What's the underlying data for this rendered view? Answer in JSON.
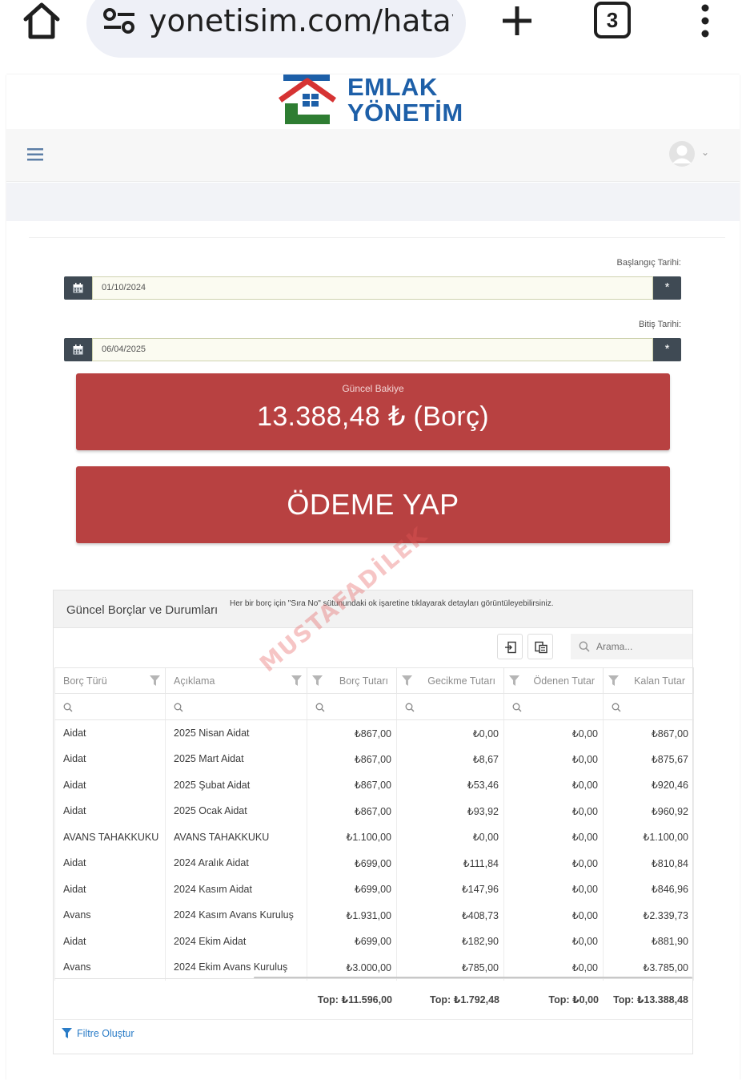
{
  "browser": {
    "url": "yonetisim.com/hatay-a",
    "tab_count": "3"
  },
  "site": {
    "logo_line1": "EMLAK",
    "logo_line2": "YÖNETİM"
  },
  "dates": {
    "start_label": "Başlangıç Tarihi:",
    "start_value": "01/10/2024",
    "end_label": "Bitiş Tarihi:",
    "end_value": "06/04/2025",
    "clear_symbol": "*"
  },
  "balance": {
    "label": "Güncel Bakiye",
    "value": "13.388,48 ₺ (Borç)"
  },
  "pay_button": "ÖDEME YAP",
  "panel": {
    "title": "Güncel Borçlar ve Durumları",
    "hint": "Her bir borç için \"Sıra No\" sütunundaki ok işaretine tıklayarak detayları görüntüleyebilirsiniz.",
    "search_placeholder": "Arama..."
  },
  "table": {
    "columns": [
      "Borç Türü",
      "Açıklama",
      "Borç Tutarı",
      "Gecikme Tutarı",
      "Ödenen Tutar",
      "Kalan Tutar"
    ],
    "rows": [
      [
        "Aidat",
        "2025 Nisan Aidat",
        "₺867,00",
        "₺0,00",
        "₺0,00",
        "₺867,00"
      ],
      [
        "Aidat",
        "2025 Mart Aidat",
        "₺867,00",
        "₺8,67",
        "₺0,00",
        "₺875,67"
      ],
      [
        "Aidat",
        "2025 Şubat Aidat",
        "₺867,00",
        "₺53,46",
        "₺0,00",
        "₺920,46"
      ],
      [
        "Aidat",
        "2025 Ocak Aidat",
        "₺867,00",
        "₺93,92",
        "₺0,00",
        "₺960,92"
      ],
      [
        "AVANS TAHAKKUKU",
        "AVANS TAHAKKUKU",
        "₺1.100,00",
        "₺0,00",
        "₺0,00",
        "₺1.100,00"
      ],
      [
        "Aidat",
        "2024 Aralık Aidat",
        "₺699,00",
        "₺111,84",
        "₺0,00",
        "₺810,84"
      ],
      [
        "Aidat",
        "2024 Kasım Aidat",
        "₺699,00",
        "₺147,96",
        "₺0,00",
        "₺846,96"
      ],
      [
        "Avans",
        "2024 Kasım Avans Kuruluş",
        "₺1.931,00",
        "₺408,73",
        "₺0,00",
        "₺2.339,73"
      ],
      [
        "Aidat",
        "2024 Ekim Aidat",
        "₺699,00",
        "₺182,90",
        "₺0,00",
        "₺881,90"
      ],
      [
        "Avans",
        "2024 Ekim Avans Kuruluş",
        "₺3.000,00",
        "₺785,00",
        "₺0,00",
        "₺3.785,00"
      ]
    ],
    "totals": {
      "borc": "Top: ₺11.596,00",
      "gecikme": "Top: ₺1.792,48",
      "odenen": "Top: ₺0,00",
      "kalan": "Top: ₺13.388,48"
    },
    "filter_link": "Filtre Oluştur"
  },
  "watermark": "MUSTAFADİLEK",
  "colors": {
    "accent_red": "#b84141",
    "dark_button": "#3f4a54",
    "logo_blue": "#1d5fa8",
    "logo_red": "#d63333",
    "logo_green": "#2e7d32",
    "link_blue": "#2a7cc7"
  }
}
